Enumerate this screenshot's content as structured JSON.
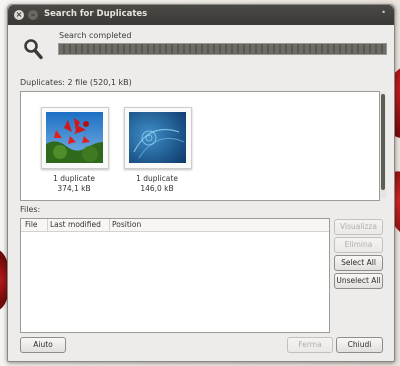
{
  "window": {
    "title": "Search for Duplicates"
  },
  "status": {
    "text": "Search completed",
    "progress_fraction": 1.0
  },
  "duplicates": {
    "header": "Duplicates: 2 file (520,1 kB)",
    "items": [
      {
        "caption": "1 duplicate",
        "size": "374,1 kB",
        "image": "red-leaves-photo"
      },
      {
        "caption": "1 duplicate",
        "size": "146,0 kB",
        "image": "blue-abstract-wallpaper"
      }
    ]
  },
  "files": {
    "label": "Files:",
    "columns": [
      "File",
      "Last modified",
      "Position"
    ],
    "rows": []
  },
  "side_buttons": {
    "view": "Visualizza",
    "delete": "Elimina",
    "select_all": "Select All",
    "unselect_all": "Unselect All"
  },
  "bottom_buttons": {
    "help": "Aiuto",
    "stop": "Ferma",
    "close": "Chiudi"
  },
  "icons": {
    "search": "search-icon",
    "close": "close-icon",
    "minimize": "minimize-icon"
  },
  "colors": {
    "titlebar": "#3c3b37",
    "window_bg": "#edecea",
    "progress": "#656560"
  }
}
